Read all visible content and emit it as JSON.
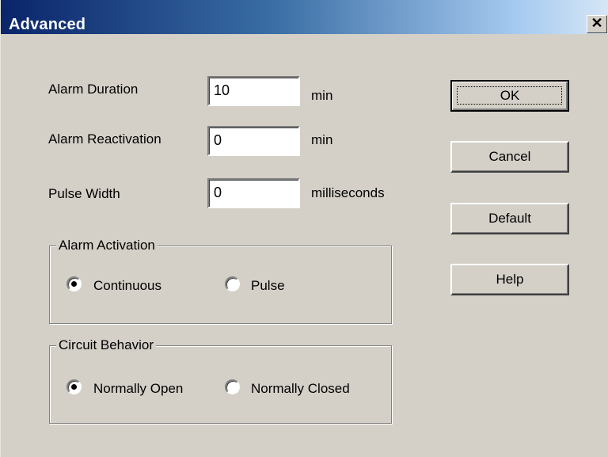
{
  "window": {
    "title": "Advanced",
    "close_glyph": "✕"
  },
  "fields": {
    "alarm_duration": {
      "label": "Alarm Duration",
      "value": "10",
      "unit": "min"
    },
    "alarm_reactivation": {
      "label": "Alarm Reactivation",
      "value": "0",
      "unit": "min"
    },
    "pulse_width": {
      "label": "Pulse Width",
      "value": "0",
      "unit": "milliseconds"
    }
  },
  "alarm_activation": {
    "legend": "Alarm Activation",
    "options": [
      {
        "label": "Continuous",
        "selected": true
      },
      {
        "label": "Pulse",
        "selected": false
      }
    ]
  },
  "circuit_behavior": {
    "legend": "Circuit Behavior",
    "options": [
      {
        "label": "Normally Open",
        "selected": true
      },
      {
        "label": "Normally Closed",
        "selected": false
      }
    ]
  },
  "buttons": {
    "ok": "OK",
    "cancel": "Cancel",
    "default": "Default",
    "help": "Help"
  },
  "colors": {
    "dialog_bg": "#d4d0c8",
    "title_start": "#0a246a",
    "title_end": "#a6caf0"
  }
}
